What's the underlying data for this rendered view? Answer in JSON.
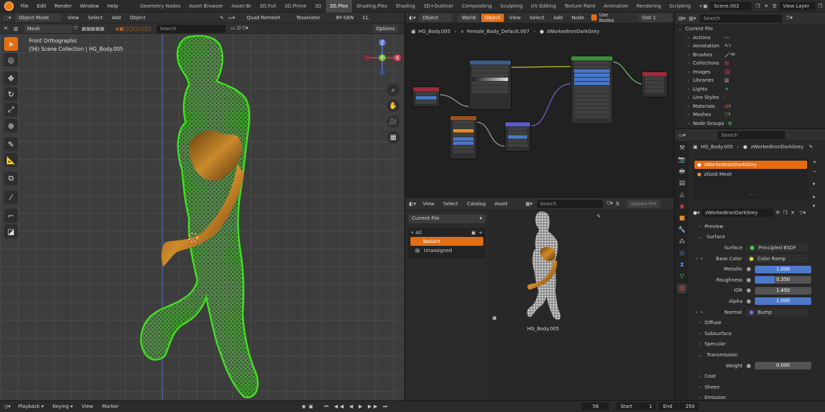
{
  "topbar": {
    "menus": [
      "File",
      "Edit",
      "Render",
      "Window",
      "Help"
    ],
    "workspaces": [
      "Geometry Nodes",
      "Asset Browser",
      "Asset-Br",
      "3D.Full",
      "3D.Prime",
      "3D",
      "3D.Plex",
      "Shading.Plex",
      "Shading",
      "3D+Outliner",
      "Compositing",
      "Sculpting",
      "UV Editing",
      "Texture Paint",
      "Animation",
      "Rendering",
      "Scripting",
      "+"
    ],
    "active_workspace": "3D.Plex",
    "scene": "Scene.002",
    "view_layer": "View Layer"
  },
  "viewport": {
    "mode": "Object Mode",
    "menus": [
      "View",
      "Select",
      "Add",
      "Object"
    ],
    "remesh": "Quad Remesh",
    "tesselator": "Tesselator",
    "bygen": "BY-GEN",
    "cl": "CL",
    "mesh_select": "Mesh",
    "search_placeholder": "Search",
    "options": "Options",
    "view_name": "Front Orthographic",
    "collection_info": "(56) Scene Collection | HG_Body.005",
    "gizmo": {
      "z": "Z",
      "y": "Y",
      "x": "X"
    },
    "tools": [
      "cursor",
      "select",
      "move",
      "rotate",
      "scale",
      "transform",
      "annotate",
      "measure",
      "add-cube",
      "draw",
      "extrude",
      "snap"
    ]
  },
  "node_editor": {
    "menus": [
      "View",
      "Select",
      "Add",
      "Node"
    ],
    "object_label": "Object",
    "world_tab": "World",
    "object_tab": "Object",
    "use_nodes": "Use Nodes",
    "slot": "Slot 1",
    "breadcrumb": [
      "HG_Body.005",
      "Female_Body_Default.007",
      "zWorkedIronDarkGrey"
    ]
  },
  "asset_browser": {
    "menus": [
      "View",
      "Select",
      "Catalog",
      "Asset"
    ],
    "search_placeholder": "Search",
    "update_preview": "Update Pre",
    "library": "Current File",
    "catalog_root": "All",
    "catalog_items": [
      "WallArt",
      "Unassigned"
    ],
    "selected_catalog": "WallArt",
    "asset_name": "HG_Body.005"
  },
  "outliner": {
    "search_placeholder": "Search",
    "root": "Current File",
    "items": [
      "Actions",
      "Annotation",
      "Brushes",
      "Collections",
      "Images",
      "Libraries",
      "Lights",
      "Line Styles",
      "Materials",
      "Meshes",
      "Node Groups"
    ],
    "counts": {
      "Annotation": "3",
      "Brushes": "48",
      "Materials": "2",
      "Meshes": "3"
    }
  },
  "properties": {
    "search_placeholder": "Search",
    "object": "HG_Body.005",
    "material": "zWorkedIronDarkGrey",
    "slots": [
      "zWorkedIronDarkGrey",
      "zGold Mesh"
    ],
    "active_slot": "zWorkedIronDarkGrey",
    "material_field": "zWorkedIronDarkGrey",
    "sections": {
      "preview": "Preview",
      "surface": "Surface",
      "diffuse": "Diffuse",
      "subsurface": "Subsurface",
      "specular": "Specular",
      "transmission": "Transmission",
      "coat": "Coat",
      "sheen": "Sheen",
      "emission": "Emission"
    },
    "surface": "Principled BSDF",
    "base_color": "Color Ramp",
    "metallic": "1.000",
    "roughness": "0.350",
    "ior": "1.450",
    "alpha": "1.000",
    "normal": "Bump",
    "weight": "0.000",
    "labels": {
      "surface": "Surface",
      "base_color": "Base Color",
      "metallic": "Metallic",
      "roughness": "Roughness",
      "ior": "IOR",
      "alpha": "Alpha",
      "normal": "Normal",
      "weight": "Weight"
    },
    "values_fraction": {
      "metallic": 1.0,
      "roughness": 0.35,
      "alpha": 1.0,
      "weight": 0.0
    }
  },
  "timeline": {
    "playback": "Playback",
    "keying": "Keying",
    "view": "View",
    "marker": "Marker",
    "current_frame": "56",
    "start_label": "Start",
    "start": "1",
    "end_label": "End",
    "end": "250"
  },
  "colors": {
    "accent": "#e36d12",
    "mesh_green": "#3fe21f",
    "gold": "#c7791a",
    "slider_blue": "#4d79c9"
  }
}
